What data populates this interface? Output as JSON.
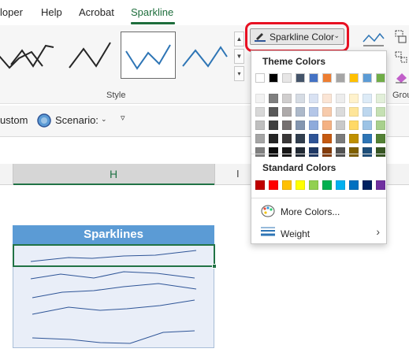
{
  "ribbon_tabs": [
    {
      "label": "loper"
    },
    {
      "label": "Help"
    },
    {
      "label": "Acrobat"
    },
    {
      "label": "Sparkline",
      "active": true
    }
  ],
  "style_group": {
    "label": "Style"
  },
  "sparkline_color_button": {
    "label": "Sparkline Color",
    "line_color": "#2f5597"
  },
  "group_label_right": "Grou",
  "row2": {
    "custom_text": "ustom",
    "scenario_label": "Scenario:"
  },
  "column_headers": {
    "h": "H",
    "i": "I"
  },
  "sparklines_table": {
    "header": "Sparklines",
    "header_color": "#5b9bd5",
    "line_color": "#2f5597"
  },
  "color_menu": {
    "theme_heading": "Theme Colors",
    "theme_colors": [
      [
        "#ffffff",
        "#000000",
        "#e7e6e6",
        "#44546a",
        "#4472c4",
        "#ed7d31",
        "#a5a5a5",
        "#ffc000",
        "#5b9bd5",
        "#70ad47"
      ],
      [
        "#f2f2f2",
        "#7f7f7f",
        "#d0cece",
        "#d6dce4",
        "#d9e2f3",
        "#fbe5d5",
        "#ededed",
        "#fff2cc",
        "#ddebf7",
        "#e2efd9"
      ],
      [
        "#d8d8d8",
        "#595959",
        "#aeaaaa",
        "#adb9ca",
        "#b4c6e7",
        "#f7cbac",
        "#dbdbdb",
        "#fee599",
        "#bdd7ee",
        "#c5e0b3"
      ],
      [
        "#bfbfbf",
        "#3f3f3f",
        "#757070",
        "#8496b0",
        "#8eaadb",
        "#f4b183",
        "#c9c9c9",
        "#ffd965",
        "#9cc3e5",
        "#a8d08d"
      ],
      [
        "#a5a5a5",
        "#262626",
        "#3a3838",
        "#323f4f",
        "#2f5496",
        "#c55a11",
        "#7b7b7b",
        "#bf9000",
        "#2e75b5",
        "#538135"
      ],
      [
        "#7f7f7f",
        "#0c0c0c",
        "#171616",
        "#222a35",
        "#1f3864",
        "#833c0b",
        "#525252",
        "#7f6000",
        "#1e4e79",
        "#375623"
      ]
    ],
    "standard_heading": "Standard Colors",
    "standard_colors": [
      "#c00000",
      "#ff0000",
      "#ffc000",
      "#ffff00",
      "#92d050",
      "#00b050",
      "#00b0f0",
      "#0070c0",
      "#002060",
      "#7030a0"
    ],
    "more_colors_label": "More Colors...",
    "weight_label": "Weight"
  }
}
